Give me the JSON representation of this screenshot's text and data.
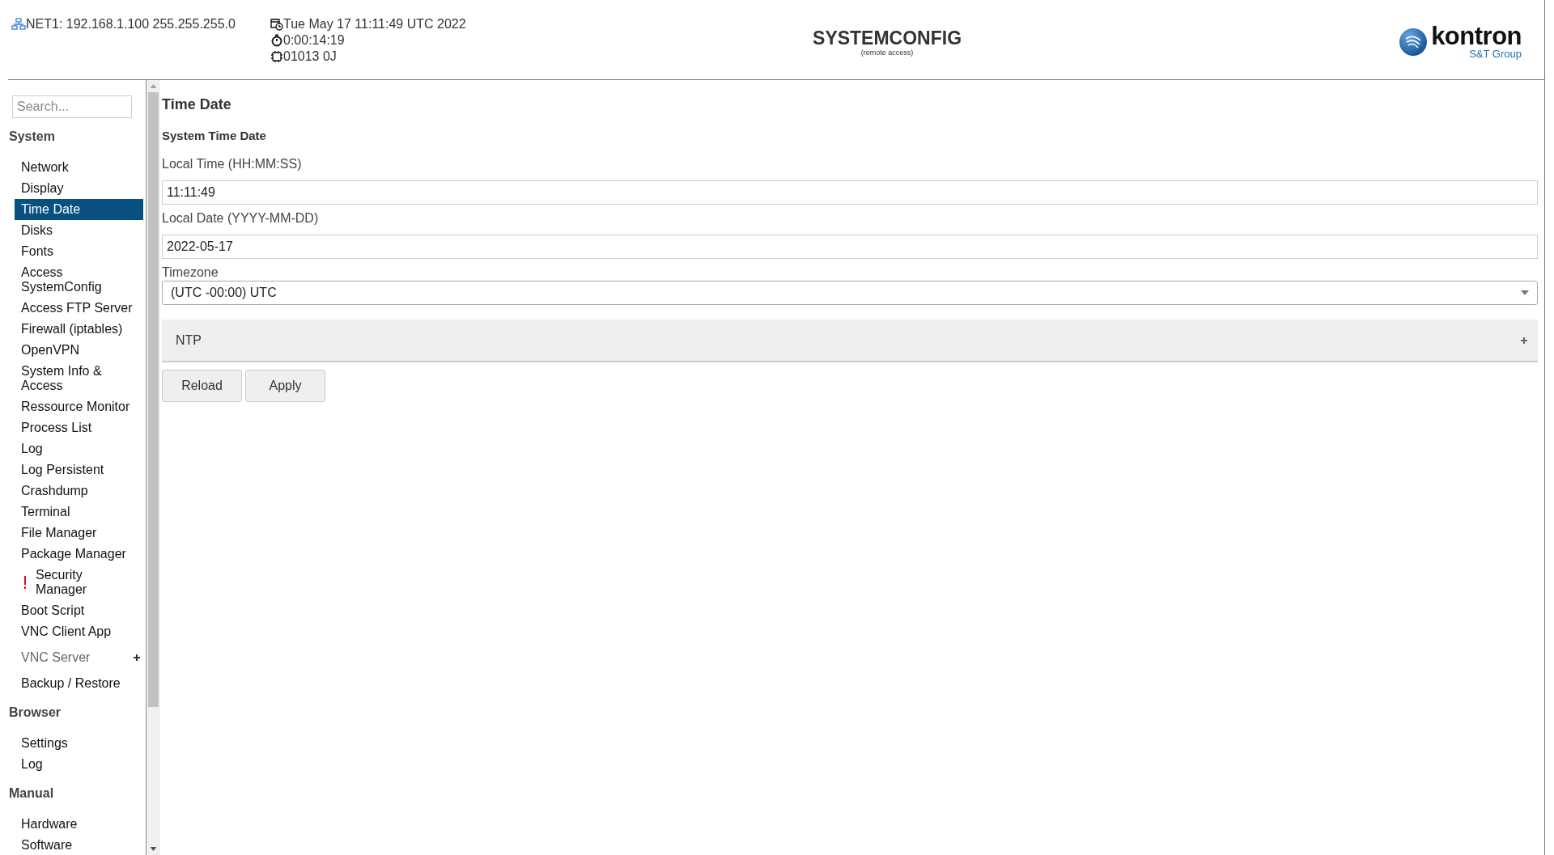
{
  "header": {
    "network": "NET1: 192.168.1.100 255.255.255.0",
    "datetime": "Tue May 17 11:11:49 UTC 2022",
    "uptime": "0:00:14:19",
    "cpu": "01013 0J",
    "title": "SYSTEMCONFIG",
    "subtitle": "(remote access)",
    "logo_name": "kontron",
    "logo_group": "S&T Group"
  },
  "sidebar": {
    "search": {
      "placeholder": "Search..."
    },
    "sections": [
      {
        "title": "System",
        "items": [
          {
            "label": "Network",
            "kind": "link",
            "selected": false
          },
          {
            "label": "Display",
            "kind": "link",
            "selected": false
          },
          {
            "label": "Time Date",
            "kind": "link",
            "selected": true
          },
          {
            "label": "Disks",
            "kind": "link",
            "selected": false
          },
          {
            "label": "Fonts",
            "kind": "link",
            "selected": false
          },
          {
            "label": "Access SystemConfig",
            "kind": "link",
            "selected": false
          },
          {
            "label": "Access FTP Server",
            "kind": "link",
            "selected": false
          },
          {
            "label": "Firewall (iptables)",
            "kind": "link",
            "selected": false
          },
          {
            "label": "OpenVPN",
            "kind": "link",
            "selected": false
          },
          {
            "label": "System Info & Access",
            "kind": "link",
            "selected": false
          },
          {
            "label": "Ressource Monitor",
            "kind": "link",
            "selected": false
          },
          {
            "label": "Process List",
            "kind": "link",
            "selected": false
          },
          {
            "label": "Log",
            "kind": "link",
            "selected": false
          },
          {
            "label": "Log Persistent",
            "kind": "link",
            "selected": false
          },
          {
            "label": "Crashdump",
            "kind": "link",
            "selected": false
          },
          {
            "label": "Terminal",
            "kind": "link",
            "selected": false
          },
          {
            "label": "File Manager",
            "kind": "link",
            "selected": false
          },
          {
            "label": "Package Manager",
            "kind": "link",
            "selected": false
          },
          {
            "label": "Security Manager",
            "kind": "warning",
            "selected": false
          },
          {
            "label": "Boot Script",
            "kind": "link",
            "selected": false
          },
          {
            "label": "VNC Client App",
            "kind": "link",
            "selected": false
          },
          {
            "label": "VNC Server",
            "kind": "group",
            "expanded": false,
            "selected": false
          },
          {
            "label": "Backup / Restore",
            "kind": "link",
            "selected": false
          }
        ]
      },
      {
        "title": "Browser",
        "items": [
          {
            "label": "Settings",
            "kind": "link",
            "selected": false
          },
          {
            "label": "Log",
            "kind": "link",
            "selected": false
          }
        ]
      },
      {
        "title": "Manual",
        "items": [
          {
            "label": "Hardware",
            "kind": "link",
            "selected": false
          },
          {
            "label": "Software",
            "kind": "link",
            "selected": false
          }
        ]
      }
    ]
  },
  "content": {
    "title": "Time Date",
    "section": "System Time Date",
    "fields": [
      {
        "label": "Local Time (HH:MM:SS)",
        "kind": "text",
        "value": "11:11:49"
      },
      {
        "label": "Local Date (YYYY-MM-DD)",
        "kind": "text",
        "value": "2022-05-17"
      },
      {
        "label": "Timezone",
        "kind": "select",
        "value": "(UTC -00:00) UTC"
      }
    ],
    "panel": {
      "title": "NTP",
      "expanded": false
    },
    "buttons": [
      "Reload",
      "Apply"
    ]
  }
}
